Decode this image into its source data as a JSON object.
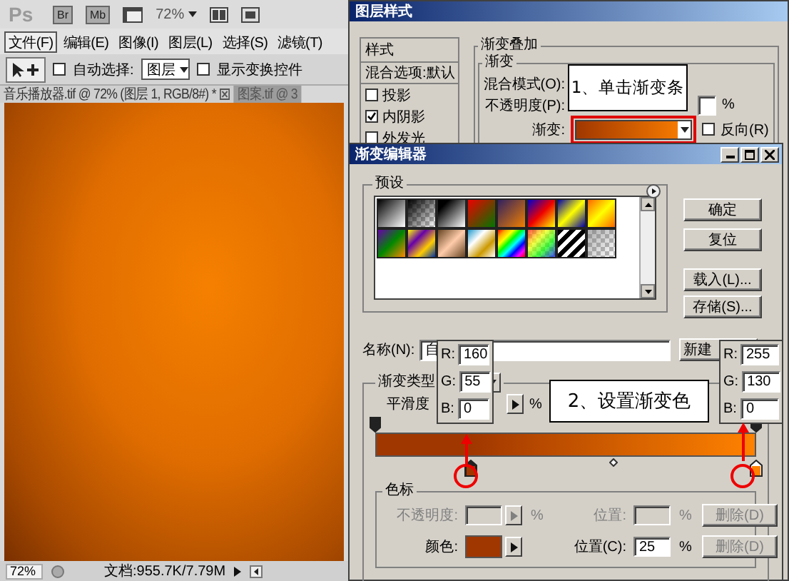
{
  "app_bar": {
    "logo": "Ps",
    "bridge": "Br",
    "mini_bridge": "Mb",
    "zoom": "72%"
  },
  "menu": [
    {
      "label": "文件(F)",
      "selected": true
    },
    {
      "label": "编辑(E)",
      "selected": false
    },
    {
      "label": "图像(I)",
      "selected": false
    },
    {
      "label": "图层(L)",
      "selected": false
    },
    {
      "label": "选择(S)",
      "selected": false
    },
    {
      "label": "滤镜(T)",
      "selected": false
    }
  ],
  "options_bar": {
    "auto_select": {
      "label": "自动选择:",
      "checked": false
    },
    "layer_select": "图层",
    "show_transform": {
      "label": "显示变换控件",
      "checked": false
    }
  },
  "doc_tabs": [
    {
      "label": "音乐播放器.tif @ 72% (图层 1, RGB/8#) *",
      "selected": true
    },
    {
      "label": "图案.tif @ 3",
      "selected": false
    }
  ],
  "status_bar": {
    "zoom": "72%",
    "doc_info": "文档:955.7K/7.79M"
  },
  "layer_style": {
    "title": "图层样式",
    "styles_header": "样式",
    "blend_default": "混合选项:默认",
    "effects": [
      {
        "label": "投影",
        "checked": false
      },
      {
        "label": "内阴影",
        "checked": true
      },
      {
        "label": "外发光",
        "checked": false
      }
    ],
    "section": "渐变叠加",
    "group": "渐变",
    "blend_mode_label": "混合模式(O):",
    "opacity_label": "不透明度(P):",
    "opacity_unit": "%",
    "gradient_label": "渐变:",
    "reverse": {
      "label": "反向(R)",
      "checked": false
    }
  },
  "gradient_editor": {
    "title": "渐变编辑器",
    "presets_label": "预设",
    "buttons": [
      "确定",
      "复位",
      "载入(L)...",
      "存储(S)..."
    ],
    "name_label": "名称(N):",
    "name_value": "自",
    "new_button": "新建",
    "type_label": "渐变类型",
    "smooth_label": "平滑度",
    "smooth_unit": "%",
    "opacity_stops": [
      {
        "level": 0
      },
      {
        "level": 1
      }
    ],
    "color_stops": [
      {
        "color": "#a03700",
        "level": 0.25,
        "selected": true
      },
      {
        "color": "#ff8200",
        "level": 1,
        "selected": false
      }
    ],
    "stops_label": "色标",
    "opacity_row": {
      "label": "不透明度:",
      "unit": "%",
      "position_label": "位置:",
      "position_unit": "%",
      "delete": "删除(D)",
      "disabled": true
    },
    "color_row": {
      "label": "颜色:",
      "color": "#a03700",
      "position_label": "位置(C):",
      "position_value": "25",
      "position_unit": "%",
      "delete": "删除(D)",
      "disabled": true
    }
  },
  "rgb_popups": [
    {
      "fields": [
        {
          "label": "R:",
          "value": "160"
        },
        {
          "label": "G:",
          "value": "55"
        },
        {
          "label": "B:",
          "value": "0"
        }
      ]
    },
    {
      "fields": [
        {
          "label": "R:",
          "value": "255"
        },
        {
          "label": "G:",
          "value": "130"
        },
        {
          "label": "B:",
          "value": "0"
        }
      ]
    }
  ],
  "callouts": [
    "1、单击渐变条",
    "2、设置渐变色"
  ]
}
